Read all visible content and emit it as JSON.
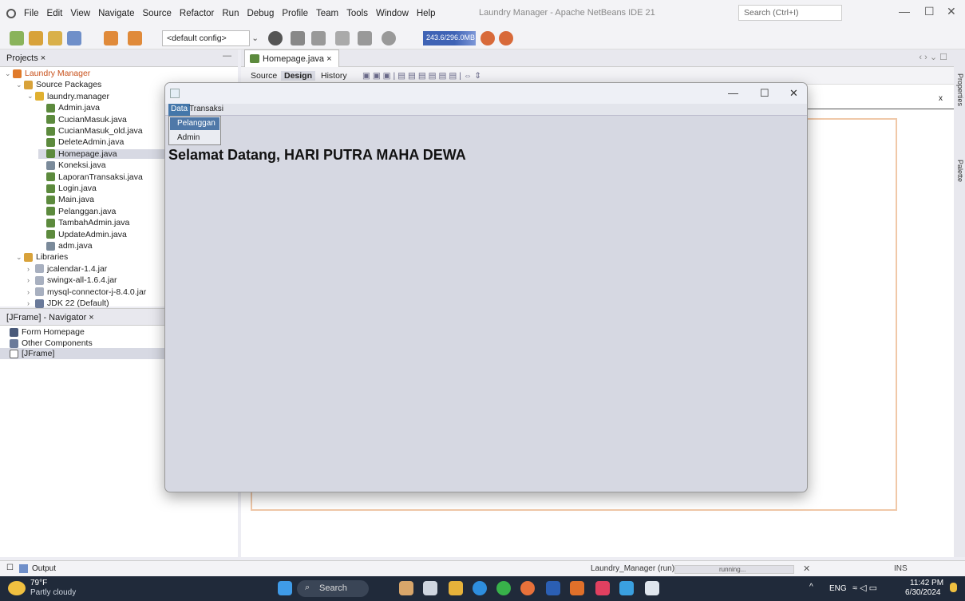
{
  "menubar": {
    "items": [
      "File",
      "Edit",
      "View",
      "Navigate",
      "Source",
      "Refactor",
      "Run",
      "Debug",
      "Profile",
      "Team",
      "Tools",
      "Window",
      "Help"
    ],
    "title": "Laundry Manager - Apache NetBeans IDE 21",
    "search_placeholder": "Search (Ctrl+I)"
  },
  "toolbar": {
    "config": "<default config>",
    "memory": "243.6/296.0MB"
  },
  "projects": {
    "tab": "Projects ×",
    "tree": [
      {
        "label": "Laundry Manager",
        "depth": 0,
        "kind": "project"
      },
      {
        "label": "Source Packages",
        "depth": 1,
        "kind": "folder"
      },
      {
        "label": "laundry.manager",
        "depth": 2,
        "kind": "package"
      },
      {
        "label": "Admin.java",
        "depth": 3,
        "kind": "form"
      },
      {
        "label": "CucianMasuk.java",
        "depth": 3,
        "kind": "form"
      },
      {
        "label": "CucianMasuk_old.java",
        "depth": 3,
        "kind": "form"
      },
      {
        "label": "DeleteAdmin.java",
        "depth": 3,
        "kind": "form"
      },
      {
        "label": "Homepage.java",
        "depth": 3,
        "kind": "form"
      },
      {
        "label": "Koneksi.java",
        "depth": 3,
        "kind": "java"
      },
      {
        "label": "LaporanTransaksi.java",
        "depth": 3,
        "kind": "form"
      },
      {
        "label": "Login.java",
        "depth": 3,
        "kind": "form"
      },
      {
        "label": "Main.java",
        "depth": 3,
        "kind": "form"
      },
      {
        "label": "Pelanggan.java",
        "depth": 3,
        "kind": "form"
      },
      {
        "label": "TambahAdmin.java",
        "depth": 3,
        "kind": "form"
      },
      {
        "label": "UpdateAdmin.java",
        "depth": 3,
        "kind": "form"
      },
      {
        "label": "adm.java",
        "depth": 3,
        "kind": "java"
      },
      {
        "label": "Libraries",
        "depth": 1,
        "kind": "folder"
      },
      {
        "label": "jcalendar-1.4.jar",
        "depth": 2,
        "kind": "jar"
      },
      {
        "label": "swingx-all-1.6.4.jar",
        "depth": 2,
        "kind": "jar"
      },
      {
        "label": "mysql-connector-j-8.4.0.jar",
        "depth": 2,
        "kind": "jar"
      },
      {
        "label": "JDK 22 (Default)",
        "depth": 2,
        "kind": "jdk"
      }
    ]
  },
  "navigator": {
    "tab": "[JFrame] - Navigator ×",
    "items": [
      "Form Homepage",
      "Other Components",
      "[JFrame]"
    ]
  },
  "editor": {
    "tab": "Homepage.java ×",
    "views": [
      "Source",
      "Design",
      "History"
    ],
    "close_label": "x"
  },
  "side_labels": [
    "Properties",
    "Palette"
  ],
  "app": {
    "menus": [
      "Data",
      "Transaksi"
    ],
    "dropdown": [
      "Pelanggan",
      "Admin"
    ],
    "welcome": "Selamat Datang, HARI PUTRA MAHA DEWA",
    "controls": [
      "—",
      "☐",
      "✕"
    ]
  },
  "statusbar": {
    "output": "Output",
    "run_label": "Laundry_Manager (run)",
    "progress": "running...",
    "mode": "INS"
  },
  "taskbar": {
    "temp": "79°F",
    "weather": "Partly cloudy",
    "search": "Search",
    "lang": "ENG",
    "time": "11:42 PM",
    "date": "6/30/2024"
  }
}
